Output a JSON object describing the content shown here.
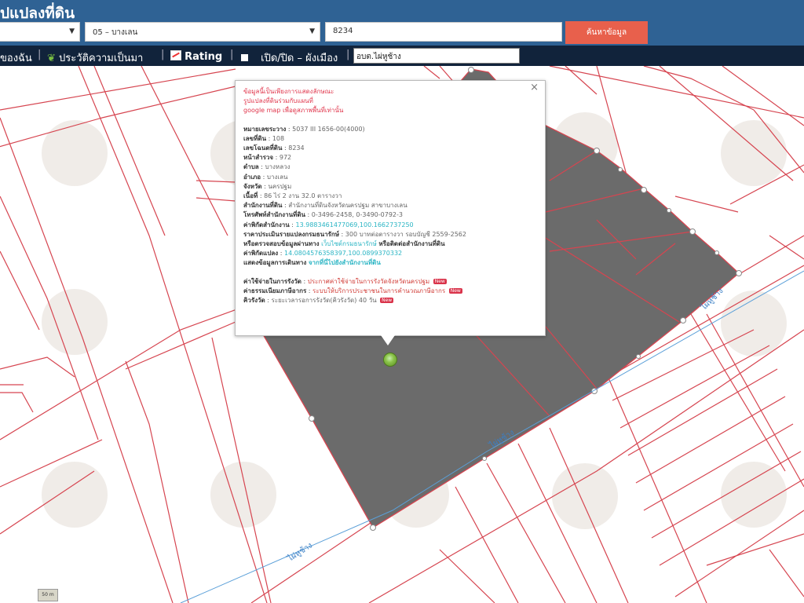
{
  "header": {
    "title": "ูปแปลงที่ดิน",
    "province_select": "",
    "district_select": "05 – บางเลน",
    "parcel_input": "8234",
    "search_button": "ค้นหาข้อมูล"
  },
  "toolbar": {
    "item1": "ของฉัน",
    "item2": "ประวัติความเป็นมา",
    "item3": "Rating",
    "item4": "เปิด/ปิด – ผังเมือง",
    "search_value": "อบต.ไผ่หูช้าง"
  },
  "popup": {
    "close": "×",
    "notice_line1": "ข้อมูลนี้เป็นเพียงการแสดงลักษณะ",
    "notice_line2": "รูปแปลงที่ดินร่วมกับแผนที่",
    "notice_line3": "google map เพื่อดูสภาพพื้นที่เท่านั้น",
    "fields": [
      {
        "label": "หมายเลขระวาง",
        "value": "5037 III 1656-00(4000)",
        "style": "v"
      },
      {
        "label": "เลขที่ดิน",
        "value": "108",
        "style": "v"
      },
      {
        "label": "เลขโฉนดที่ดิน",
        "value": "8234",
        "style": "v"
      },
      {
        "label": "หน้าสำรวจ",
        "value": "972",
        "style": "v"
      },
      {
        "label": "ตำบล",
        "value": "บางหลวง",
        "style": "v"
      },
      {
        "label": "อำเภอ",
        "value": "บางเลน",
        "style": "v"
      },
      {
        "label": "จังหวัด",
        "value": "นครปฐม",
        "style": "v"
      },
      {
        "label": "เนื้อที่",
        "value": "86 ไร่ 2 งาน 32.0 ตารางวา",
        "style": "v"
      },
      {
        "label": "สำนักงานที่ดิน",
        "value": "สำนักงานที่ดินจังหวัดนครปฐม สาขาบางเลน",
        "style": "v"
      },
      {
        "label": "โทรศัพท์สำนักงานที่ดิน",
        "value": "0-3496-2458, 0-3490-0792-3",
        "style": "v"
      },
      {
        "label": "ค่าพิกัดสำนักงาน",
        "value": "13.9883461477069,100.1662737250",
        "style": "teal"
      },
      {
        "label": "ราคาประเมินรายแปลงกรมธนารักษ์",
        "value": "300 บาทต่อตารางวา รอบบัญชี 2559-2562",
        "style": "v"
      }
    ],
    "treasury_line_prefix": "หรือตรวจสอบข้อมูลผ่านทาง",
    "treasury_link": "เว็บไซต์กรมธนารักษ์",
    "treasury_line_suffix": "หรือติดต่อสำนักงานที่ดิน",
    "parcel_coord_label": "ค่าพิกัดแปลง",
    "parcel_coord_value": "14.0804576358397,100.0899370332",
    "route_label": "แสดงข้อมูลการเดินทาง",
    "route_link": "จากที่นี่ไปยังสำนักงานที่ดิน",
    "cost_label": "ค่าใช้จ่ายในการรังวัด",
    "cost_link": "ประกาศค่าใช้จ่ายในการรังวัดจังหวัดนครปฐม",
    "fee_label": "ค่าธรรมเนียมภาษีอากร",
    "fee_link": "ระบบให้บริการประชาชนในการคำนวณภาษีอากร",
    "queue_label": "คิวรังวัด",
    "queue_value": "ระยะเวลารอการรังวัด(คิวรังวัด) 40 วัน",
    "new_badge": "New"
  },
  "map": {
    "road_label_1": "ไผ่หูช้าง",
    "road_label_2": "ไผ่หูช้าง",
    "road_label_3": "ไผ่หูช้าง",
    "scale_label": "50 m"
  },
  "colors": {
    "header_bg": "#2f6294",
    "toolbar_bg": "#11233b",
    "search_button": "#e8604c",
    "parcel_fill": "#6b6b6b",
    "parcel_line": "#d64550",
    "road_line": "#5a9fd8"
  }
}
